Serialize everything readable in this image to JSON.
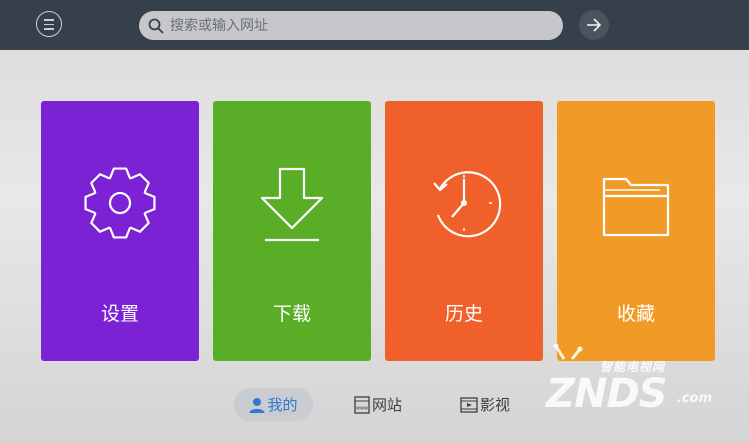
{
  "search": {
    "placeholder": "搜索或输入网址"
  },
  "tiles": [
    {
      "label": "设置",
      "color": "#7a22d4",
      "icon": "gear-icon"
    },
    {
      "label": "下载",
      "color": "#5aad26",
      "icon": "download-arrow-icon"
    },
    {
      "label": "历史",
      "color": "#f0602a",
      "icon": "clock-history-icon"
    },
    {
      "label": "收藏",
      "color": "#f29a26",
      "icon": "folder-icon"
    }
  ],
  "tabs": [
    {
      "label": "我的",
      "icon": "person-icon",
      "active": true
    },
    {
      "label": "网站",
      "icon": "web-page-icon",
      "active": false
    },
    {
      "label": "影视",
      "icon": "film-icon",
      "active": false
    }
  ],
  "watermark": {
    "top": "智能电视网",
    "main": "ZNDS",
    "domain": ".com"
  },
  "colors": {
    "topbar": "#36404a",
    "active_tab_text": "#2e7ad1"
  }
}
